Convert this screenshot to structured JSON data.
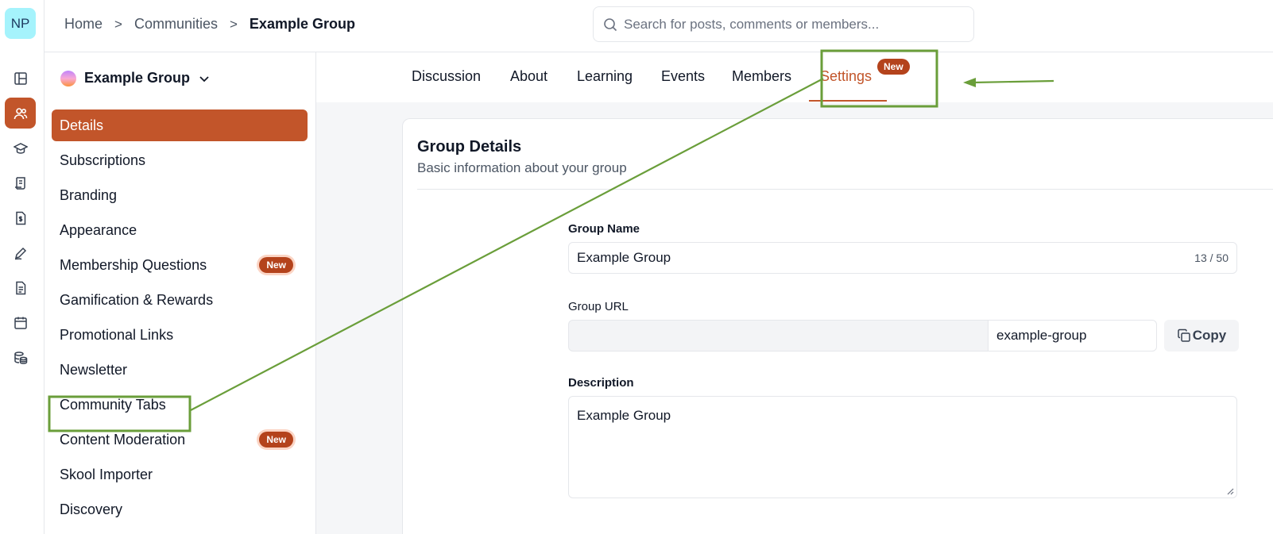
{
  "rail": {
    "avatar": "NP",
    "accent": "#c2552a",
    "icons": [
      "layout-icon",
      "users-icon",
      "graduation-cap-icon",
      "scroll-icon",
      "dollar-file-icon",
      "pen-icon",
      "document-icon",
      "calendar-icon",
      "database-icon"
    ]
  },
  "header": {
    "breadcrumb": [
      "Home",
      "Communities",
      "Example Group"
    ],
    "search_placeholder": "Search for posts, comments or members..."
  },
  "sidebar": {
    "group_name": "Example Group",
    "items": [
      {
        "label": "Details",
        "active": true,
        "badge": ""
      },
      {
        "label": "Subscriptions",
        "badge": ""
      },
      {
        "label": "Branding",
        "badge": ""
      },
      {
        "label": "Appearance",
        "badge": ""
      },
      {
        "label": "Membership Questions",
        "badge": "New"
      },
      {
        "label": "Gamification & Rewards",
        "badge": ""
      },
      {
        "label": "Promotional Links",
        "badge": ""
      },
      {
        "label": "Newsletter",
        "badge": ""
      },
      {
        "label": "Community Tabs",
        "badge": ""
      },
      {
        "label": "Content Moderation",
        "badge": "New"
      },
      {
        "label": "Skool Importer",
        "badge": ""
      },
      {
        "label": "Discovery",
        "badge": ""
      }
    ]
  },
  "tabs": {
    "items": [
      "Discussion",
      "About",
      "Learning",
      "Events",
      "Members",
      "Settings"
    ],
    "active": "Settings",
    "settings_badge": "New"
  },
  "card": {
    "title": "Group Details",
    "subtitle": "Basic information about your group",
    "group_name_label": "Group Name",
    "group_name_value": "Example Group",
    "group_name_counter": "13 / 50",
    "group_url_label": "Group URL",
    "group_url_prefix": "",
    "group_url_value": "example-group",
    "copy_label": "Copy",
    "description_label": "Description",
    "description_value": "Example Group"
  },
  "annotation_color": "#6a9e3a"
}
